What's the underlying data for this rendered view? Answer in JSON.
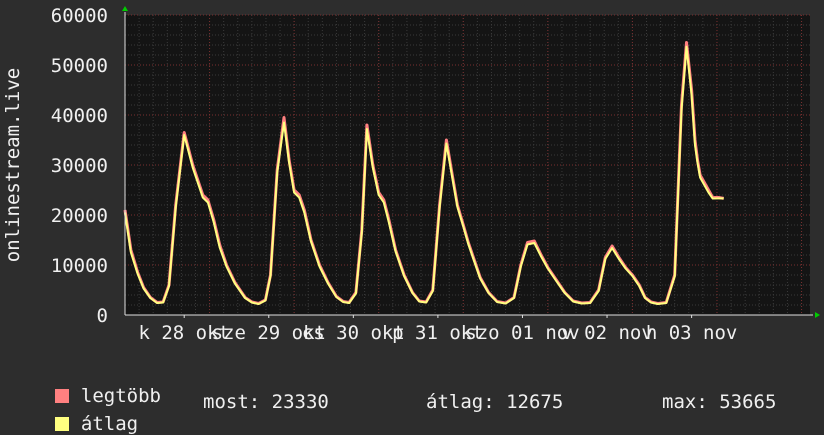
{
  "chart_data": {
    "type": "line",
    "ylabel": "onlinestream.live",
    "ylim": [
      0,
      60000
    ],
    "yticks": [
      0,
      10000,
      20000,
      30000,
      40000,
      50000,
      60000
    ],
    "ytick_labels": [
      "0",
      "10000",
      "20000",
      "30000",
      "40000",
      "50000",
      "60000"
    ],
    "xlim": [
      0,
      8.1
    ],
    "xtick_labels": [
      {
        "label": "k 28 okt",
        "x": 0.7
      },
      {
        "label": "sze 29 okt",
        "x": 1.7
      },
      {
        "label": "cs 30 okt",
        "x": 2.7
      },
      {
        "label": "p 31 okt",
        "x": 3.7
      },
      {
        "label": "szo 01 nov",
        "x": 4.7
      },
      {
        "label": "v 02 nov",
        "x": 5.7
      },
      {
        "label": "h 03 nov",
        "x": 6.7
      }
    ],
    "grid": true,
    "colors": {
      "background": "#2d2d2d",
      "plot_bg": "#141414",
      "grid_major": "#7a2f2f",
      "grid_minor": "#3a3a3a",
      "axis": "#e0e0e0",
      "text": "#f0f0f0",
      "max_series": "#ff8080",
      "avg_series": "#ffff80",
      "arrow": "#00cc00"
    },
    "series": [
      {
        "name": "legtöbb",
        "color": "#ff8080",
        "x": [
          0,
          0.07,
          0.15,
          0.22,
          0.3,
          0.38,
          0.45,
          0.52,
          0.6,
          0.7,
          0.8,
          0.92,
          0.98,
          1.05,
          1.12,
          1.2,
          1.3,
          1.42,
          1.5,
          1.58,
          1.66,
          1.72,
          1.8,
          1.88,
          1.94,
          2.0,
          2.06,
          2.12,
          2.2,
          2.3,
          2.4,
          2.5,
          2.58,
          2.65,
          2.73,
          2.8,
          2.86,
          2.93,
          3.0,
          3.06,
          3.12,
          3.2,
          3.3,
          3.4,
          3.48,
          3.56,
          3.64,
          3.72,
          3.8,
          3.86,
          3.93,
          4.0,
          4.06,
          4.12,
          4.2,
          4.3,
          4.4,
          4.5,
          4.6,
          4.68,
          4.76,
          4.84,
          4.92,
          5.0,
          5.1,
          5.2,
          5.3,
          5.4,
          5.5,
          5.6,
          5.68,
          5.76,
          5.84,
          5.92,
          6.0,
          6.08,
          6.15,
          6.22,
          6.3,
          6.4,
          6.5,
          6.58,
          6.64,
          6.7,
          6.74,
          6.77,
          6.8,
          6.85,
          6.9,
          6.95,
          7.02,
          7.08
        ],
        "values": [
          21000,
          13000,
          8500,
          5500,
          3500,
          2500,
          2600,
          6000,
          22000,
          36500,
          30000,
          24000,
          23000,
          19000,
          14000,
          10000,
          6500,
          3500,
          2600,
          2300,
          3000,
          8000,
          29000,
          39500,
          31000,
          25000,
          24000,
          21000,
          15000,
          10000,
          6500,
          3700,
          2700,
          2500,
          4500,
          17000,
          38000,
          30000,
          24500,
          23000,
          19000,
          13000,
          8000,
          4500,
          2800,
          2600,
          5000,
          22000,
          35000,
          29000,
          22000,
          18000,
          14500,
          11500,
          7500,
          4500,
          2700,
          2400,
          3500,
          10000,
          14500,
          14800,
          12000,
          9500,
          7000,
          4500,
          2800,
          2400,
          2500,
          5000,
          11500,
          13800,
          11500,
          9500,
          8000,
          6000,
          3500,
          2600,
          2300,
          2500,
          8000,
          42000,
          54500,
          45000,
          35000,
          31000,
          28000,
          26500,
          25000,
          23500,
          23500,
          23330
        ]
      },
      {
        "name": "átlag",
        "color": "#ffff80",
        "x": [
          0,
          0.07,
          0.15,
          0.22,
          0.3,
          0.38,
          0.45,
          0.52,
          0.6,
          0.7,
          0.8,
          0.92,
          0.98,
          1.05,
          1.12,
          1.2,
          1.3,
          1.42,
          1.5,
          1.58,
          1.66,
          1.72,
          1.8,
          1.88,
          1.94,
          2.0,
          2.06,
          2.12,
          2.2,
          2.3,
          2.4,
          2.5,
          2.58,
          2.65,
          2.73,
          2.8,
          2.86,
          2.93,
          3.0,
          3.06,
          3.12,
          3.2,
          3.3,
          3.4,
          3.48,
          3.56,
          3.64,
          3.72,
          3.8,
          3.86,
          3.93,
          4.0,
          4.06,
          4.12,
          4.2,
          4.3,
          4.4,
          4.5,
          4.6,
          4.68,
          4.76,
          4.84,
          4.92,
          5.0,
          5.1,
          5.2,
          5.3,
          5.4,
          5.5,
          5.6,
          5.68,
          5.76,
          5.84,
          5.92,
          6.0,
          6.08,
          6.15,
          6.22,
          6.3,
          6.4,
          6.5,
          6.58,
          6.64,
          6.7,
          6.74,
          6.77,
          6.8,
          6.85,
          6.9,
          6.95,
          7.02,
          7.08
        ],
        "values": [
          20500,
          12500,
          8200,
          5300,
          3400,
          2400,
          2500,
          5800,
          21500,
          36000,
          29500,
          23500,
          22500,
          18500,
          13500,
          9700,
          6300,
          3400,
          2500,
          2200,
          2900,
          7800,
          28500,
          38500,
          30500,
          24500,
          23500,
          20500,
          14700,
          9700,
          6300,
          3600,
          2600,
          2400,
          4300,
          16500,
          37200,
          29500,
          24000,
          22500,
          18500,
          12700,
          7800,
          4400,
          2700,
          2500,
          4800,
          21500,
          34300,
          28500,
          21600,
          17700,
          14200,
          11200,
          7300,
          4400,
          2600,
          2300,
          3400,
          9700,
          14100,
          14400,
          11700,
          9300,
          6800,
          4400,
          2700,
          2300,
          2400,
          4800,
          11200,
          13400,
          11200,
          9300,
          7800,
          5800,
          3400,
          2500,
          2200,
          2400,
          7700,
          41000,
          53665,
          44000,
          34000,
          30500,
          27500,
          26000,
          24500,
          23300,
          23330,
          23330
        ]
      }
    ]
  },
  "legend": {
    "max_label": "legtöbb",
    "avg_label": "átlag"
  },
  "stats": {
    "now": "most: 23330",
    "average": "átlag: 12675",
    "max": "max: 53665"
  }
}
